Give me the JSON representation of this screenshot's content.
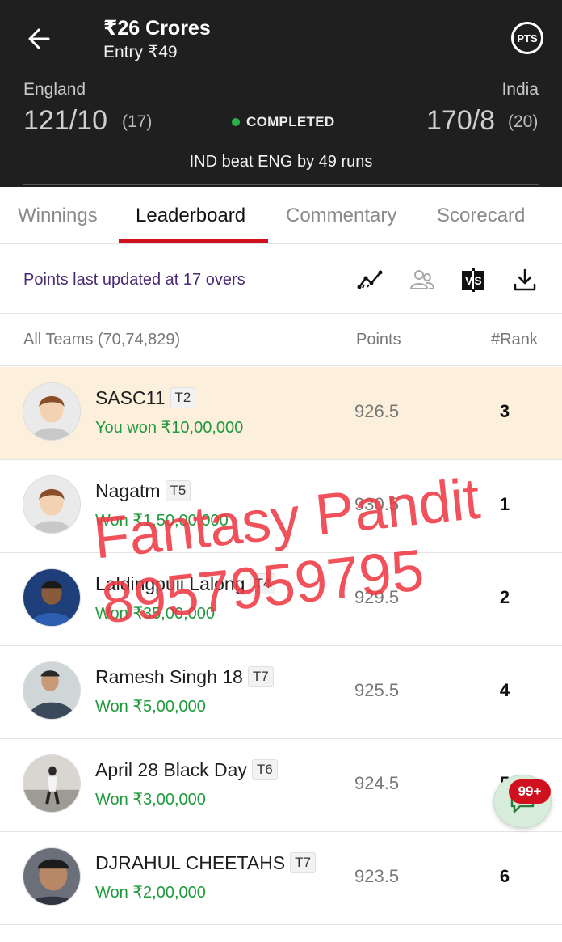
{
  "header": {
    "contest_title": "₹26 Crores",
    "entry": "Entry ₹49",
    "pts_label": "PTS",
    "left_team": {
      "name": "England",
      "score": "121/10",
      "overs": "(17)"
    },
    "right_team": {
      "name": "India",
      "score": "170/8",
      "overs": "(20)"
    },
    "status": "COMPLETED",
    "result": "IND beat ENG by 49 runs"
  },
  "tabs": [
    {
      "label": "Winnings",
      "active": false
    },
    {
      "label": "Leaderboard",
      "active": true
    },
    {
      "label": "Commentary",
      "active": false
    },
    {
      "label": "Scorecard",
      "active": false
    }
  ],
  "toolbar": {
    "updated_text": "Points last updated at 17 overs",
    "icons": [
      "trend-icon",
      "compare-users-icon",
      "vs-icon",
      "download-icon"
    ],
    "vs_label": "VS"
  },
  "columns": {
    "teams": "All Teams (70,74,829)",
    "points": "Points",
    "rank": "#Rank"
  },
  "rows": [
    {
      "name": "SASC11",
      "team": "T2",
      "winning": "You won ₹10,00,000",
      "points": "926.5",
      "rank": "3",
      "highlight": true
    },
    {
      "name": "Nagatm",
      "team": "T5",
      "winning": "Won ₹1,50,00,000",
      "points": "930.5",
      "rank": "1"
    },
    {
      "name": "Laldingpuii Lalong",
      "team": "T4",
      "winning": "Won ₹35,00,000",
      "points": "929.5",
      "rank": "2"
    },
    {
      "name": "Ramesh Singh 18",
      "team": "T7",
      "winning": "Won ₹5,00,000",
      "points": "925.5",
      "rank": "4"
    },
    {
      "name": "April 28 Black Day",
      "team": "T6",
      "winning": "Won ₹3,00,000",
      "points": "924.5",
      "rank": "5"
    },
    {
      "name": "DJRAHUL CHEETAHS",
      "team": "T7",
      "winning": "Won ₹2,00,000",
      "points": "923.5",
      "rank": "6"
    }
  ],
  "chat": {
    "badge": "99+"
  },
  "watermark": {
    "line1": "Fantasy Pandit",
    "line2": "8957959795"
  },
  "colors": {
    "header_bg": "#1f1f1f",
    "accent_red": "#d0101e",
    "win_green": "#1f9a3c",
    "highlight_row": "#fcf0dc",
    "watermark": "#ee3a44"
  }
}
